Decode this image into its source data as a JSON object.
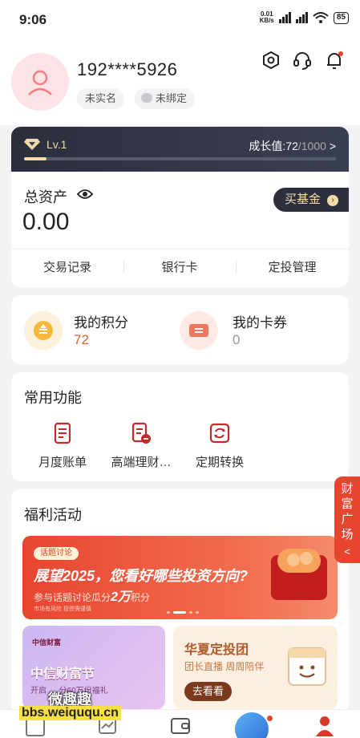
{
  "status_bar": {
    "time": "9:06",
    "net_speed_value": "0.01",
    "net_speed_unit": "KB/s",
    "battery": "85"
  },
  "profile": {
    "phone": "192****5926",
    "tag_realname": "未实名",
    "tag_bind": "未绑定"
  },
  "level": {
    "label": "Lv.1",
    "growth_label": "成长值:",
    "growth_value": "72",
    "growth_max": "/1000",
    "progress": 0.072
  },
  "assets": {
    "title": "总资产",
    "amount": "0.00",
    "buy_button": "买基金",
    "links": [
      "交易记录",
      "银行卡",
      "定投管理"
    ]
  },
  "points": {
    "label": "我的积分",
    "value": "72"
  },
  "coupons": {
    "label": "我的卡券",
    "value": "0"
  },
  "common": {
    "title": "常用功能",
    "items": [
      "月度账单",
      "高端理财…",
      "定期转换"
    ]
  },
  "side_tab": {
    "text": "财富广场"
  },
  "welfare": {
    "title": "福利活动",
    "banner_tag": "话题讨论",
    "banner_title": "展望2025，您看好哪些投资方向?",
    "banner_sub_pre": "参与话题讨论瓜分",
    "banner_sub_amount": "2万",
    "banner_sub_post": "积分",
    "banner_footer": "市场有风险 投资需谨慎",
    "promo1_brand": "中信财富",
    "promo1_title": "中信财富节",
    "promo1_sub": "开启 … 分60万份福礼",
    "promo2_title": "华夏定投团",
    "promo2_sub": "团长直播 周周陪伴",
    "promo2_button": "去看看"
  },
  "watermark": {
    "line1": "微趣趣",
    "line2": "bbs.weiququ.cn"
  },
  "colors": {
    "accent": "#e8452f",
    "orange": "#e0622e",
    "dark": "#2c2f3e"
  }
}
